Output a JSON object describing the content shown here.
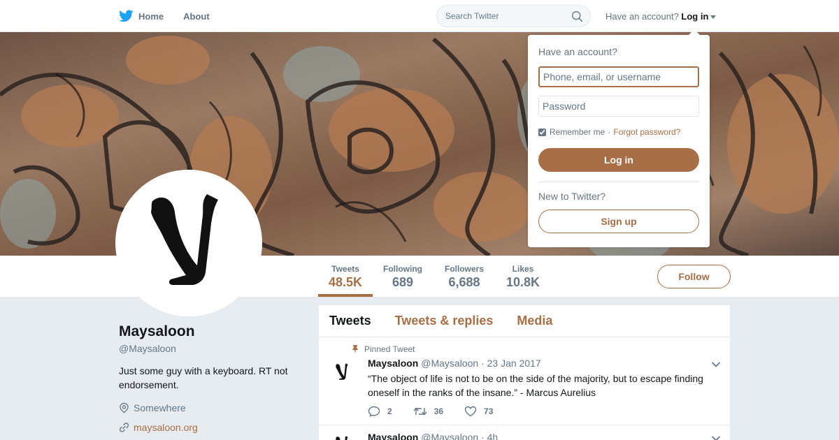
{
  "nav": {
    "home": "Home",
    "about": "About",
    "search_placeholder": "Search Twitter",
    "have_account": "Have an account?",
    "login": "Log in"
  },
  "profile": {
    "name": "Maysaloon",
    "handle": "@Maysaloon",
    "bio": "Just some guy with a keyboard. RT not endorsement.",
    "location": "Somewhere",
    "website": "maysaloon.org"
  },
  "stats": [
    {
      "label": "Tweets",
      "value": "48.5K"
    },
    {
      "label": "Following",
      "value": "689"
    },
    {
      "label": "Followers",
      "value": "6,688"
    },
    {
      "label": "Likes",
      "value": "10.8K"
    }
  ],
  "follow_label": "Follow",
  "tabs": [
    "Tweets",
    "Tweets & replies",
    "Media"
  ],
  "tweets": [
    {
      "pinned": "Pinned Tweet",
      "name": "Maysaloon",
      "handle": "@Maysaloon",
      "date": "· 23 Jan 2017",
      "text": "“The object of life is not to be on the side of the majority, but to escape finding oneself in the ranks of the insane.” - Marcus Aurelius",
      "replies": "2",
      "retweets": "36",
      "likes": "73"
    },
    {
      "name": "Maysaloon",
      "handle": "@Maysaloon",
      "date": "· 4h"
    }
  ],
  "login_dropdown": {
    "title": "Have an account?",
    "username_placeholder": "Phone, email, or username",
    "password_placeholder": "Password",
    "remember": "Remember me",
    "separator": "·",
    "forgot": "Forgot password?",
    "login_button": "Log in",
    "new_to": "New to Twitter?",
    "signup_button": "Sign up"
  },
  "colors": {
    "accent": "#a86e45",
    "twitter_blue": "#1da1f2",
    "background": "#e6ecf0"
  }
}
